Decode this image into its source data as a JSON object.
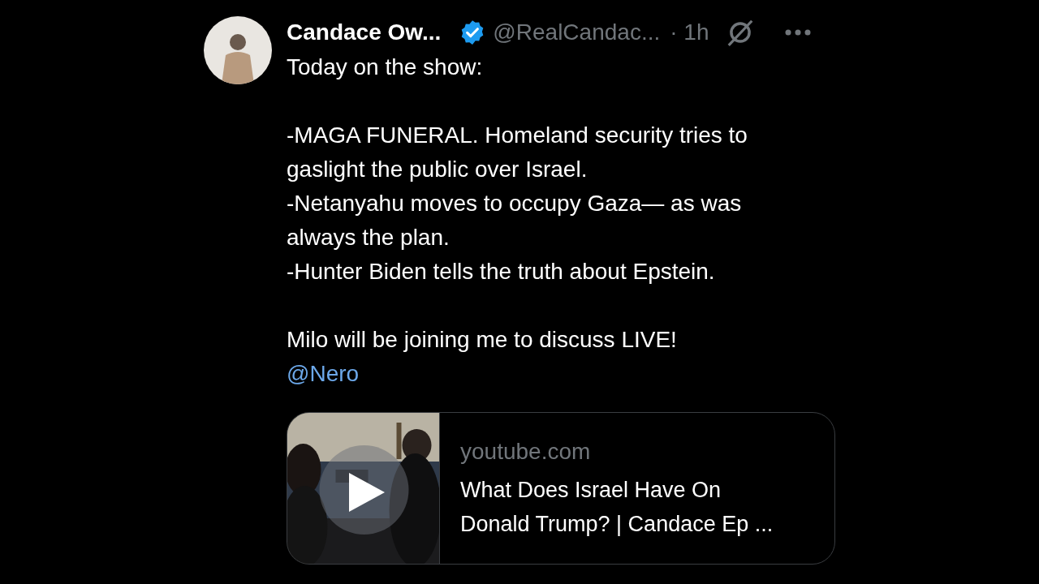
{
  "post": {
    "author_name": "Candace Ow...",
    "verified": true,
    "handle": "@RealCandac...",
    "time": "· 1h",
    "paragraphs": [
      [
        "Today on the show:"
      ],
      [
        "-MAGA FUNERAL. Homeland security tries to gaslight the public over Israel.",
        "-Netanyahu moves to occupy Gaza— as was always the plan.",
        "-Hunter Biden tells the truth about Epstein."
      ],
      [
        "Milo will be joining me to discuss LIVE!"
      ]
    ],
    "mention": "@Nero",
    "link_card": {
      "domain": "youtube.com",
      "title": "What Does Israel Have On Donald Trump? | Candace Ep ..."
    }
  }
}
